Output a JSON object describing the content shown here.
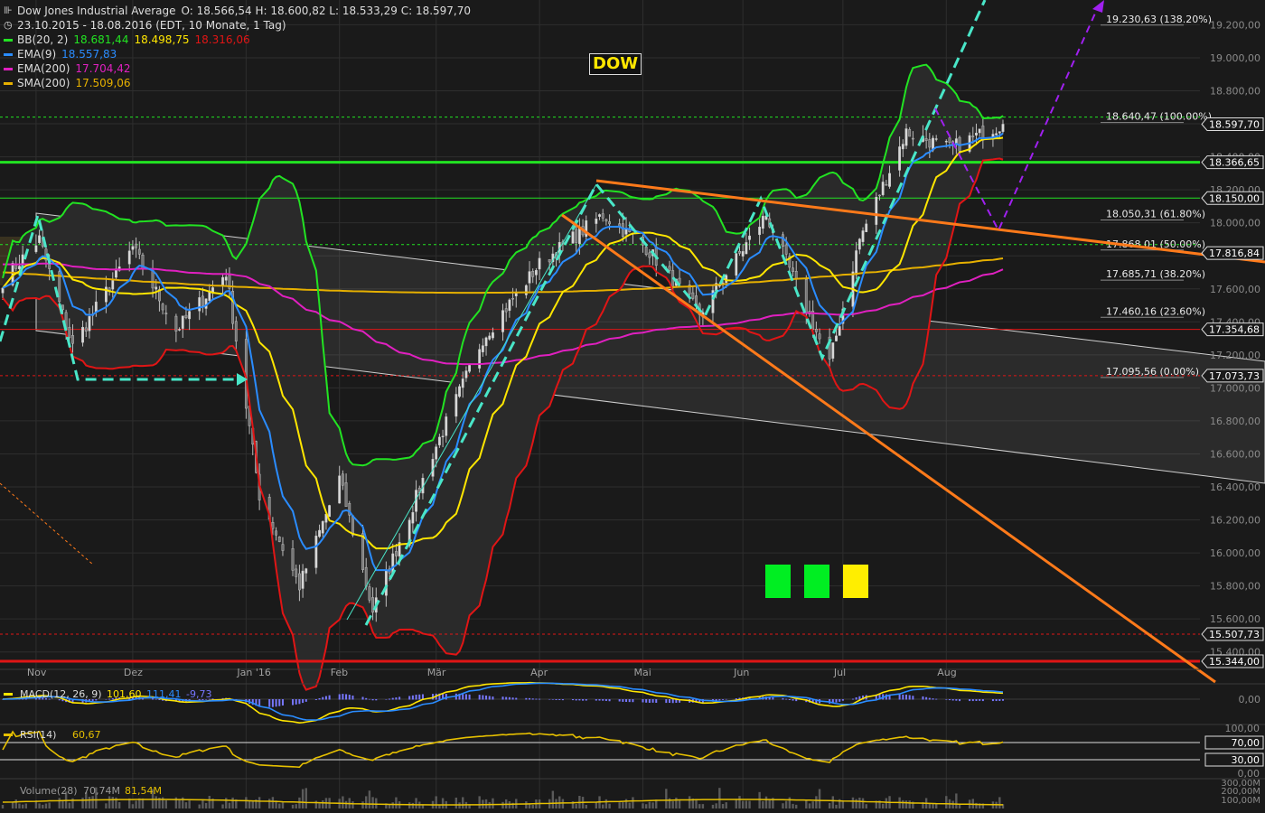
{
  "header": {
    "title": "Dow Jones Industrial Average",
    "ohlc": "O: 18.566,54  H: 18.600,82  L: 18.533,29  C: 18.597,70",
    "range": "23.10.2015 - 18.08.2016 (EDT, 10 Monate, 1 Tag)"
  },
  "indicators": [
    {
      "name": "BB(20, 2)",
      "values": [
        "18.681,44",
        "18.498,75",
        "18.316,06"
      ],
      "colors": [
        "#22e322",
        "#ffe600",
        "#e01515"
      ]
    },
    {
      "name": "EMA(9)",
      "values": [
        "18.557,83"
      ],
      "colors": [
        "#2a8cff"
      ]
    },
    {
      "name": "EMA(200)",
      "values": [
        "17.704,42"
      ],
      "colors": [
        "#e020c0"
      ]
    },
    {
      "name": "SMA(200)",
      "values": [
        "17.509,06"
      ],
      "colors": [
        "#e6b000"
      ]
    }
  ],
  "annotation_label": "DOW",
  "colors": {
    "bg": "#1a1a1a",
    "grid": "#2e2e2e",
    "candle": "#c8c8c8",
    "bb_upper": "#22e322",
    "bb_mid": "#ffe600",
    "bb_lower": "#e01515",
    "ema9": "#2a8cff",
    "ema200": "#e020c0",
    "sma200": "#e6b000",
    "cyan": "#49e6c8",
    "orange": "#ff7a1a",
    "purple": "#a020f0",
    "fib": "#8a8a8a",
    "green_line": "#22e322",
    "red_line": "#e01515"
  },
  "chart_data": {
    "type": "line",
    "title": "Dow Jones Industrial Average",
    "x": [
      "Nov",
      "Dez",
      "Jan '16",
      "Feb",
      "Mär",
      "Apr",
      "Mai",
      "Jun",
      "Jul",
      "Aug"
    ],
    "y_ticks": [
      "19.200,00",
      "19.000,00",
      "18.800,00",
      "18.600,00",
      "18.400,00",
      "18.200,00",
      "18.000,00",
      "17.800,00",
      "17.600,00",
      "17.400,00",
      "17.200,00",
      "17.000,00",
      "16.800,00",
      "16.600,00",
      "16.400,00",
      "16.200,00",
      "16.000,00",
      "15.800,00",
      "15.600,00",
      "15.400,00"
    ],
    "ylim": [
      15300,
      19350
    ],
    "close_anchors": [
      {
        "d": "2015-10-23",
        "v": 17650
      },
      {
        "d": "2015-11-03",
        "v": 17900
      },
      {
        "d": "2015-11-13",
        "v": 17250
      },
      {
        "d": "2015-12-01",
        "v": 17850
      },
      {
        "d": "2015-12-14",
        "v": 17350
      },
      {
        "d": "2015-12-29",
        "v": 17700
      },
      {
        "d": "2016-01-08",
        "v": 16350
      },
      {
        "d": "2016-01-20",
        "v": 15800
      },
      {
        "d": "2016-02-01",
        "v": 16450
      },
      {
        "d": "2016-02-11",
        "v": 15650
      },
      {
        "d": "2016-02-29",
        "v": 16600
      },
      {
        "d": "2016-03-15",
        "v": 17300
      },
      {
        "d": "2016-04-01",
        "v": 17750
      },
      {
        "d": "2016-04-20",
        "v": 18050
      },
      {
        "d": "2016-05-03",
        "v": 17850
      },
      {
        "d": "2016-05-19",
        "v": 17450
      },
      {
        "d": "2016-06-08",
        "v": 18050
      },
      {
        "d": "2016-06-27",
        "v": 17150
      },
      {
        "d": "2016-07-06",
        "v": 17900
      },
      {
        "d": "2016-07-20",
        "v": 18550
      },
      {
        "d": "2016-08-02",
        "v": 18450
      },
      {
        "d": "2016-08-18",
        "v": 18597.7
      }
    ],
    "series": [
      {
        "name": "BB(20, 2)",
        "last": [
          18681.44,
          18498.75,
          18316.06
        ]
      },
      {
        "name": "EMA(9)",
        "last": 18557.83
      },
      {
        "name": "EMA(200)",
        "last": 17704.42
      },
      {
        "name": "SMA(200)",
        "last": 17509.06
      }
    ],
    "price_labels": [
      {
        "value": "18.597,70",
        "y": 18597.7,
        "color": "#ffffff",
        "text_color": "#111"
      },
      {
        "value": "18.366,65",
        "y": 18366.65,
        "color": "#ffffff",
        "text_color": "#111"
      },
      {
        "value": "18.150,00",
        "y": 18150,
        "color": "#ffffff",
        "text_color": "#111"
      },
      {
        "value": "17.816,84",
        "y": 17816.84,
        "color": "#ffffff",
        "text_color": "#111"
      },
      {
        "value": "17.354,68",
        "y": 17354.68,
        "color": "#ffffff",
        "text_color": "#111"
      },
      {
        "value": "17.073,73",
        "y": 17073.73,
        "color": "#ffffff",
        "text_color": "#111"
      },
      {
        "value": "15.507,73",
        "y": 15507.73,
        "color": "#ffffff",
        "text_color": "#111"
      },
      {
        "value": "15.344,00",
        "y": 15344,
        "color": "#ffffff",
        "text_color": "#111"
      }
    ],
    "fibonacci": [
      {
        "label": "19.230,63 (138.20%)",
        "y": 19230.63
      },
      {
        "label": "18.640,47 (100.00%)",
        "y": 18640.47
      },
      {
        "label": "18.050,31 (61.80%)",
        "y": 18050.31
      },
      {
        "label": "17.868,01 (50.00%)",
        "y": 17868.01
      },
      {
        "label": "17.685,71 (38.20%)",
        "y": 17685.71
      },
      {
        "label": "17.460,16 (23.60%)",
        "y": 17460.16
      },
      {
        "label": "17.095,56 (0.00%)",
        "y": 17095.56
      }
    ],
    "horizontal_lines": [
      {
        "y": 18366.65,
        "color": "#22e322",
        "width": 3
      },
      {
        "y": 18150,
        "color": "#22e322",
        "width": 1
      },
      {
        "y": 15344,
        "color": "#e01515",
        "width": 3
      }
    ]
  },
  "macd": {
    "label": "MACD(12, 26, 9)",
    "values": [
      "101,60",
      "111,41",
      "-9,73"
    ],
    "colors": [
      "#ffe600",
      "#2a8cff",
      "#7777ff"
    ],
    "axis": [
      "0,00"
    ]
  },
  "rsi": {
    "label": "RSI(14)",
    "value": "60,67",
    "axis": [
      "100,00",
      "70,00",
      "30,00",
      "0,00"
    ]
  },
  "volume": {
    "label": "Volume(28)",
    "values": [
      "70,74M",
      "81,54M"
    ],
    "axis": [
      "300,00M",
      "200,00M",
      "100,00M"
    ]
  }
}
